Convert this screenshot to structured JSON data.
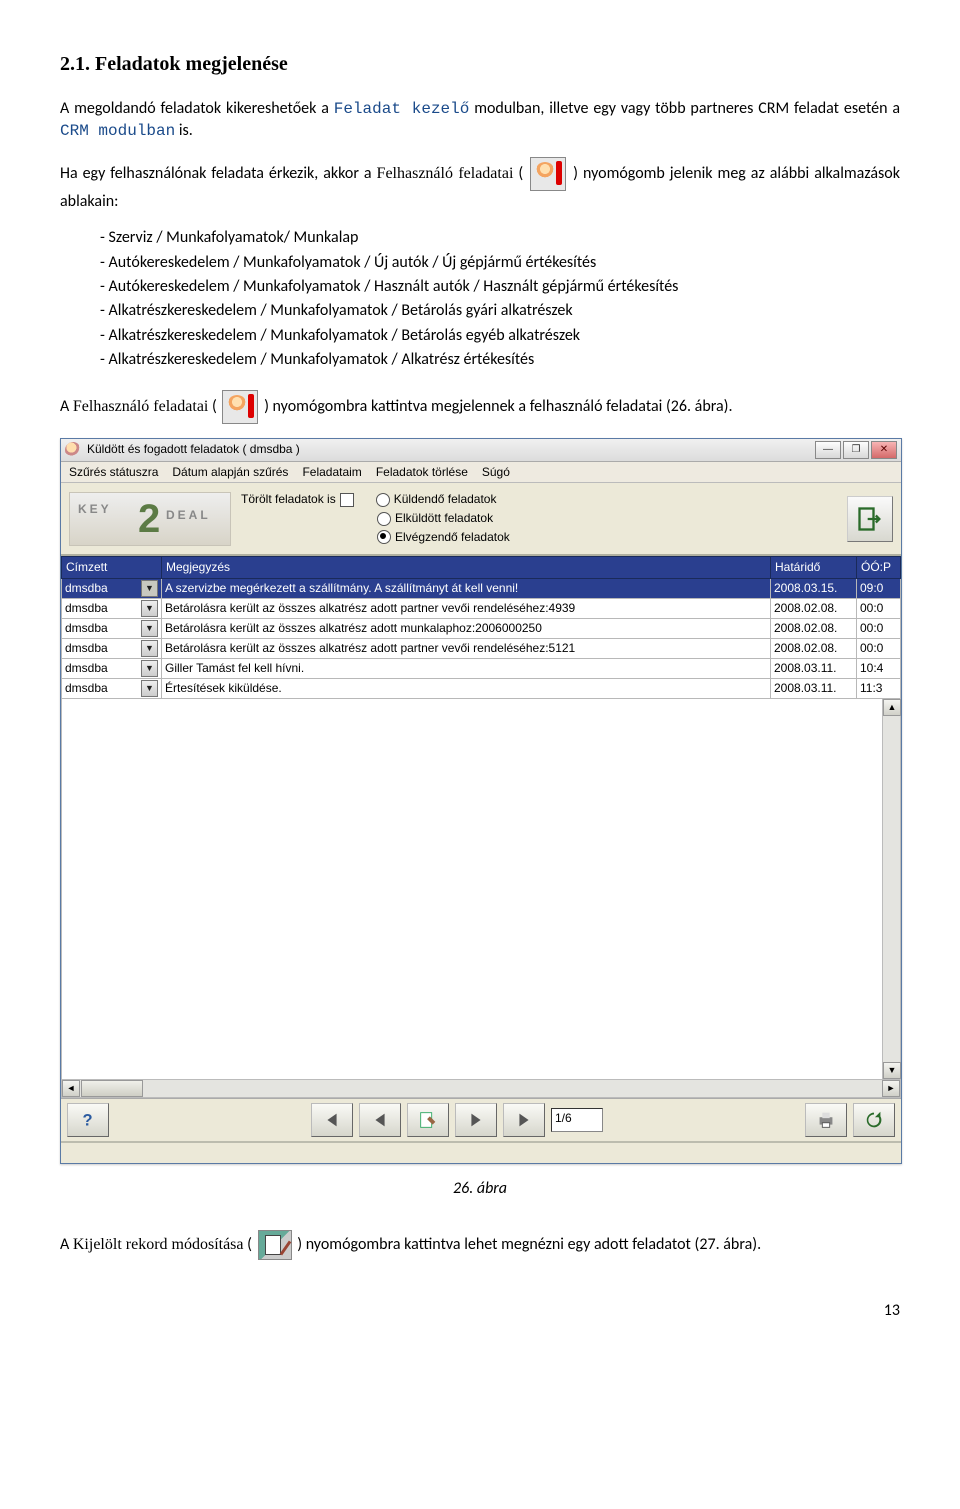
{
  "heading": "2.1.  Feladatok megjelenése",
  "para1_a": "A megoldandó feladatok kikereshetőek a ",
  "para1_b": "Feladat kezelő",
  "para1_c": " modulban, illetve egy vagy több partneres CRM feladat esetén a ",
  "para1_d": "CRM modulban",
  "para1_e": " is.",
  "para2_a": "Ha egy felhasználónak feladata érkezik, akkor a ",
  "para2_b": "Felhasználó feladatai",
  "para2_c": " ( ",
  "para2_d": " ) nyomógomb jelenik meg az alábbi alkalmazások ablakain:",
  "bullets": [
    "Szerviz / Munkafolyamatok/ Munkalap",
    "Autókereskedelem / Munkafolyamatok / Új autók / Új gépjármű értékesítés",
    "Autókereskedelem / Munkafolyamatok / Használt autók / Használt gépjármű értékesítés",
    "Alkatrészkereskedelem / Munkafolyamatok / Betárolás gyári alkatrészek",
    "Alkatrészkereskedelem / Munkafolyamatok / Betárolás egyéb alkatrészek",
    "Alkatrészkereskedelem / Munkafolyamatok / Alkatrész értékesítés"
  ],
  "para3_a": "A ",
  "para3_b": "Felhasználó feladatai",
  "para3_c": " ( ",
  "para3_d": " ) nyomógombra kattintva megjelennek a felhasználó feladatai (26. ábra).",
  "window": {
    "title": "Küldött és fogadott feladatok ( dmsdba )",
    "menu": [
      "Szűrés státuszra",
      "Dátum alapján szűrés",
      "Feladataim",
      "Feladatok törlése",
      "Súgó"
    ],
    "chk_label": "Törölt feladatok is",
    "radio1": "Küldendő feladatok",
    "radio2": "Elküldött feladatok",
    "radio3": "Elvégzendő feladatok",
    "logo_key": "KEY",
    "logo_2": "2",
    "logo_deal": "DEAL",
    "columns": {
      "c1": "Címzett",
      "c2": "Megjegyzés",
      "c3": "Határidő",
      "c4": "ÓÓ:P"
    },
    "rows": [
      {
        "to": "dmsdba",
        "note": "A szervizbe megérkezett a szállítmány. A szállítmányt át kell venni!",
        "date": "2008.03.15.",
        "time": "09:0"
      },
      {
        "to": "dmsdba",
        "note": "Betárolásra került az összes alkatrész adott partner vevői rendeléséhez:4939",
        "date": "2008.02.08.",
        "time": "00:0"
      },
      {
        "to": "dmsdba",
        "note": "Betárolásra került az összes alkatrész adott munkalaphoz:2006000250",
        "date": "2008.02.08.",
        "time": "00:0"
      },
      {
        "to": "dmsdba",
        "note": "Betárolásra került az összes alkatrész adott partner vevői rendeléséhez:5121",
        "date": "2008.02.08.",
        "time": "00:0"
      },
      {
        "to": "dmsdba",
        "note": "Giller Tamást fel kell hívni.",
        "date": "2008.03.11.",
        "time": "10:4"
      },
      {
        "to": "dmsdba",
        "note": "Értesítések kiküldése.",
        "date": "2008.03.11.",
        "time": "11:3"
      }
    ],
    "page": "1/6"
  },
  "caption1": "26. ábra",
  "para4_a": "A ",
  "para4_b": "Kijelölt rekord módosítása",
  "para4_c": " ( ",
  "para4_d": " ) nyomógombra kattintva lehet megnézni egy adott feladatot (27. ábra).",
  "pagenum": "13"
}
